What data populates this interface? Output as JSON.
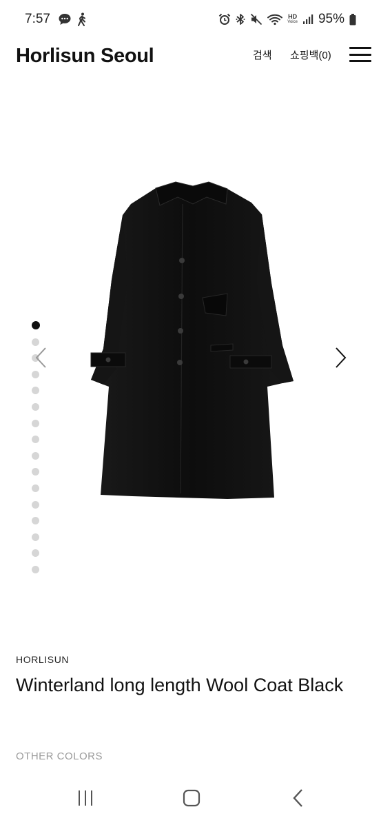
{
  "status_bar": {
    "time": "7:57",
    "battery_percent": "95%",
    "left_icons": [
      "chat-bubble-icon",
      "walking-person-icon"
    ],
    "right_icons": [
      "alarm-icon",
      "bluetooth-icon",
      "mute-icon",
      "wifi-icon",
      "hd-voice-icon",
      "signal-icon",
      "battery-icon"
    ],
    "hd_label": "HD",
    "voice_label": "Voice"
  },
  "header": {
    "brand": "Horlisun Seoul",
    "search_label": "검색",
    "bag_label": "쇼핑백(0)",
    "menu_icon": "hamburger-menu-icon"
  },
  "gallery": {
    "image_count": 16,
    "active_index": 0,
    "image_alt": "Black wool coat",
    "prev_icon": "chevron-left-icon",
    "next_icon": "chevron-right-icon"
  },
  "product": {
    "brand_label": "HORLISUN",
    "title": "Winterland long length Wool Coat Black",
    "other_colors_label": "OTHER COLORS"
  },
  "navbar": {
    "recents_icon": "recent-apps-icon",
    "home_icon": "home-icon",
    "back_icon": "back-icon"
  },
  "colors": {
    "text": "#111111",
    "muted": "#9a9a9a",
    "dot_inactive": "#d6d6d6",
    "coat": "#111111"
  }
}
